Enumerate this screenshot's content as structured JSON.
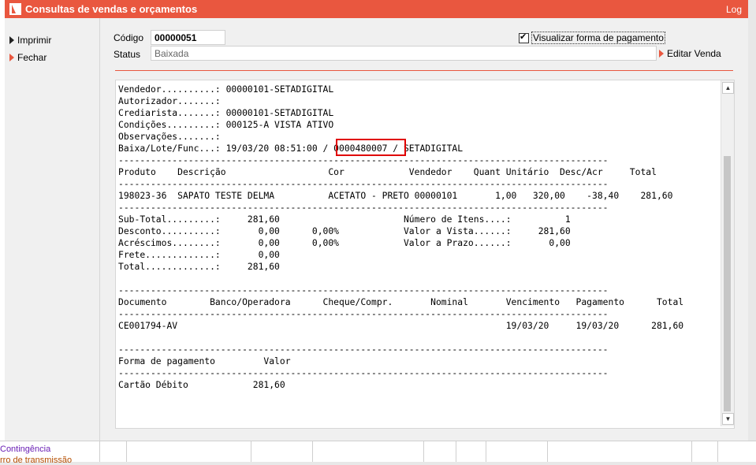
{
  "window": {
    "title": "Consultas de vendas e orçamentos",
    "log_label": "Log",
    "accent_color": "#e9573f"
  },
  "sidebar": {
    "items": [
      {
        "label": "Imprimir",
        "icon": "black-triangle-icon"
      },
      {
        "label": "Fechar",
        "icon": "orange-triangle-icon"
      }
    ]
  },
  "form": {
    "codigo_label": "Código",
    "codigo_value": "00000051",
    "status_label": "Status",
    "status_value": "Baixada",
    "visualizar_checkbox": {
      "label": "Visualizar forma de pagamento",
      "checked": true
    },
    "editar_venda_label": "Editar Venda"
  },
  "report": {
    "highlighted_value": "0000480007",
    "lines": [
      "Vendedor..........: 00000101-SETADIGITAL",
      "Autorizador.......:",
      "Crediarista.......: 00000101-SETADIGITAL",
      "Condições.........: 000125-A VISTA ATIVO",
      "Observações.......:",
      "Baixa/Lote/Func...: 19/03/20 08:51:00 / 0000480007 / SETADIGITAL",
      "-------------------------------------------------------------------------------------------",
      "Produto    Descrição                   Cor            Vendedor    Quant Unitário  Desc/Acr     Total",
      "-------------------------------------------------------------------------------------------",
      "198023-36  SAPATO TESTE DELMA          ACETATO - PRETO 00000101       1,00   320,00    -38,40    281,60",
      "-------------------------------------------------------------------------------------------",
      "Sub-Total.........:     281,60                       Número de Itens....:          1",
      "Desconto..........:       0,00      0,00%            Valor a Vista......:     281,60",
      "Acréscimos........:       0,00      0,00%            Valor a Prazo......:       0,00",
      "Frete.............:       0,00",
      "Total.............:     281,60",
      "",
      "-------------------------------------------------------------------------------------------",
      "Documento        Banco/Operadora      Cheque/Compr.       Nominal       Vencimento   Pagamento      Total",
      "-------------------------------------------------------------------------------------------",
      "CE001794-AV                                                             19/03/20     19/03/20      281,60",
      "",
      "-------------------------------------------------------------------------------------------",
      "Forma de pagamento         Valor",
      "-------------------------------------------------------------------------------------------",
      "Cartão Débito            281,60"
    ]
  },
  "background": {
    "contingencia_label": "Contingência",
    "transmissao_label": "rro de transmissão"
  }
}
